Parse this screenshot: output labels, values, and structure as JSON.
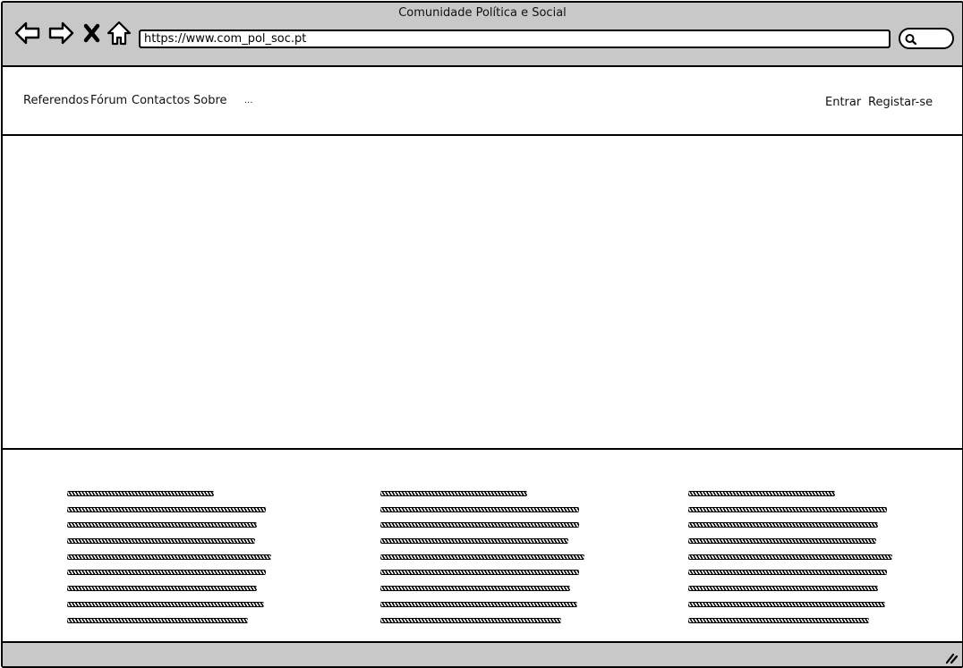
{
  "window": {
    "title": "Comunidade Política e Social"
  },
  "toolbar": {
    "back_icon": "back-arrow-icon",
    "forward_icon": "forward-arrow-icon",
    "stop_icon": "close-x-icon",
    "home_icon": "home-icon",
    "url": "https://www.com_pol_soc.pt",
    "search_icon": "search-icon"
  },
  "nav": {
    "items": [
      {
        "label": "Referendos"
      },
      {
        "label": "Fórum"
      },
      {
        "label": "Contactos"
      },
      {
        "label": "Sobre"
      },
      {
        "label": "..."
      }
    ],
    "login_label": "Entrar",
    "register_label": "Registar-se"
  },
  "colors": {
    "chrome_gray": "#c8c8c8",
    "border": "#000000",
    "background": "#ffffff"
  },
  "footer": {
    "columns": [
      {
        "placeholder": "scribble-text-block"
      },
      {
        "placeholder": "scribble-text-block"
      },
      {
        "placeholder": "scribble-text-block"
      }
    ]
  }
}
